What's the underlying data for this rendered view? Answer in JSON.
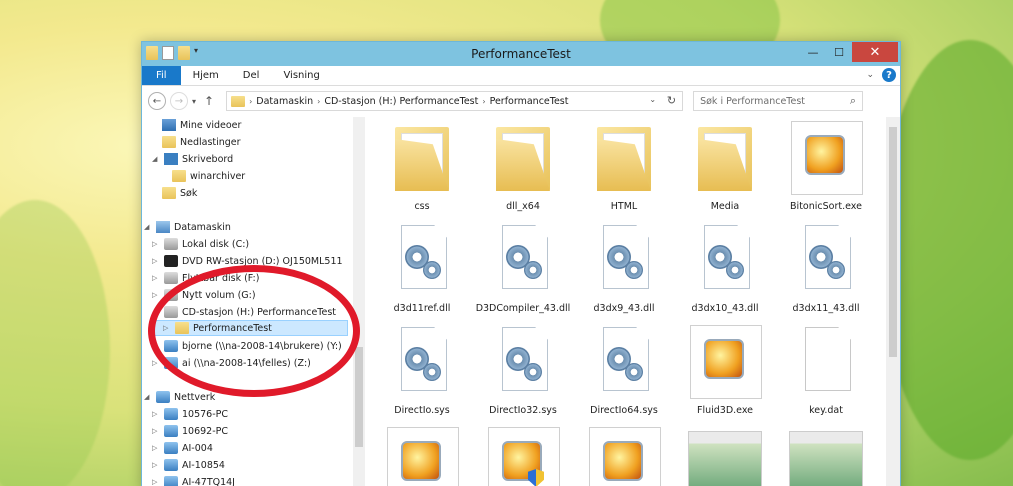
{
  "window": {
    "title": "PerformanceTest",
    "controls": {
      "minimize": "—",
      "maximize": "☐",
      "close": "✕"
    }
  },
  "ribbon": {
    "tabs": [
      "Fil",
      "Hjem",
      "Del",
      "Visning"
    ],
    "help": "?"
  },
  "address": {
    "segments": [
      "Datamaskin",
      "CD-stasjon (H:) PerformanceTest",
      "PerformanceTest"
    ]
  },
  "search": {
    "placeholder": "Søk i PerformanceTest"
  },
  "nav_tree": [
    {
      "label": "Mine videoer"
    },
    {
      "label": "Nedlastinger"
    },
    {
      "label": "Skrivebord"
    },
    {
      "label": "winarchiver"
    },
    {
      "label": "Søk"
    },
    {
      "label": "Datamaskin"
    },
    {
      "label": "Lokal disk (C:)"
    },
    {
      "label": "DVD RW-stasjon (D:) OJ150ML511"
    },
    {
      "label": "Flyttbar disk (F:)"
    },
    {
      "label": "Nytt volum (G:)"
    },
    {
      "label": "CD-stasjon (H:) PerformanceTest"
    },
    {
      "label": "PerformanceTest"
    },
    {
      "label": "bjorne (\\\\na-2008-14\\brukere) (Y:)"
    },
    {
      "label": "ai (\\\\na-2008-14\\felles) (Z:)"
    },
    {
      "label": "Nettverk"
    },
    {
      "label": "10576-PC"
    },
    {
      "label": "10692-PC"
    },
    {
      "label": "AI-004"
    },
    {
      "label": "AI-10854"
    },
    {
      "label": "AI-47TQ14J"
    }
  ],
  "files": [
    {
      "name": "css",
      "type": "folder"
    },
    {
      "name": "dll_x64",
      "type": "folder"
    },
    {
      "name": "HTML",
      "type": "folder"
    },
    {
      "name": "Media",
      "type": "folder"
    },
    {
      "name": "BitonicSort.exe",
      "type": "exe"
    },
    {
      "name": "d3d11ref.dll",
      "type": "dll"
    },
    {
      "name": "D3DCompiler_43.dll",
      "type": "dll"
    },
    {
      "name": "d3dx9_43.dll",
      "type": "dll"
    },
    {
      "name": "d3dx10_43.dll",
      "type": "dll"
    },
    {
      "name": "d3dx11_43.dll",
      "type": "dll"
    },
    {
      "name": "DirectIo.sys",
      "type": "dll"
    },
    {
      "name": "DirectIo32.sys",
      "type": "dll"
    },
    {
      "name": "DirectIo64.sys",
      "type": "dll"
    },
    {
      "name": "Fluid3D.exe",
      "type": "exe"
    },
    {
      "name": "key.dat",
      "type": "blank"
    },
    {
      "name": "",
      "type": "exe"
    },
    {
      "name": "",
      "type": "exe-shield"
    },
    {
      "name": "",
      "type": "exe"
    },
    {
      "name": "",
      "type": "shot"
    },
    {
      "name": "",
      "type": "shot"
    }
  ]
}
